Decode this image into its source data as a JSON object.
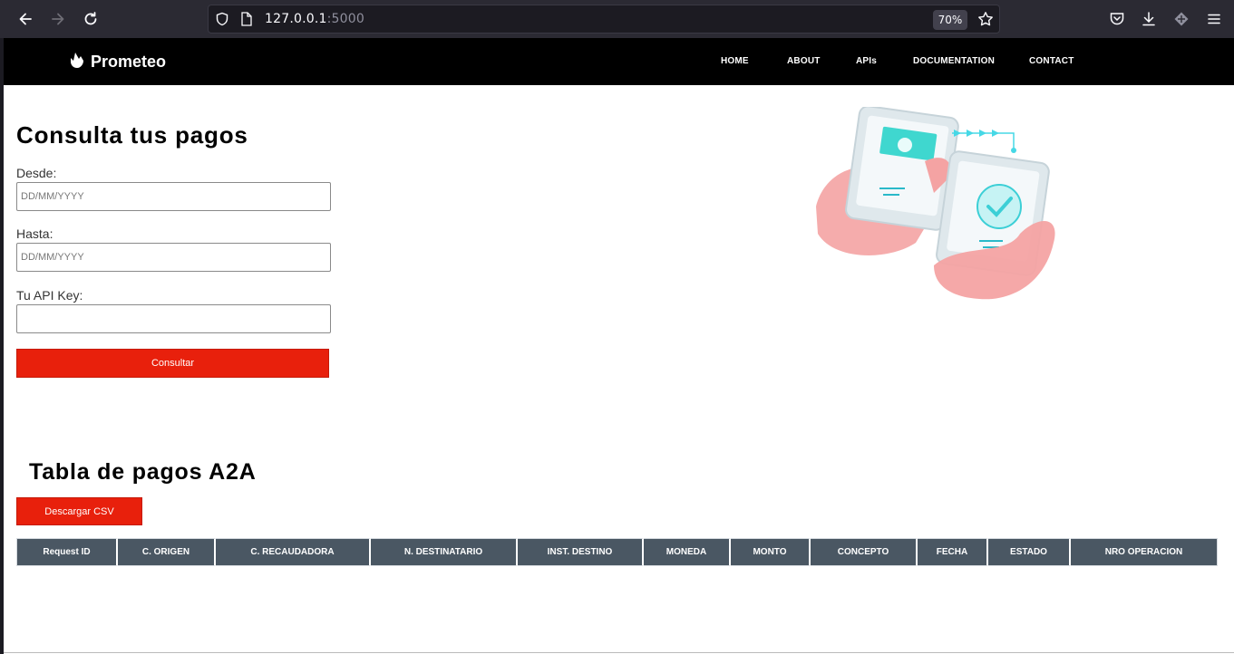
{
  "browser": {
    "url_host": "127.0.0.1",
    "url_port": ":5000",
    "zoom": "70%"
  },
  "nav": {
    "brand": "Prometeo",
    "links": [
      "HOME",
      "ABOUT",
      "APIs",
      "DOCUMENTATION",
      "CONTACT"
    ]
  },
  "form": {
    "title": "Consulta tus pagos",
    "desde_label": "Desde:",
    "desde_placeholder": "DD/MM/YYYY",
    "hasta_label": "Hasta:",
    "hasta_placeholder": "DD/MM/YYYY",
    "apikey_label": "Tu API Key:",
    "apikey_value": "",
    "submit_label": "Consultar"
  },
  "table": {
    "title": "Tabla de pagos A2A",
    "download_label": "Descargar CSV",
    "headers": [
      "Request ID",
      "C. ORIGEN",
      "C. RECAUDADORA",
      "N. DESTINATARIO",
      "INST. DESTINO",
      "MONEDA",
      "MONTO",
      "CONCEPTO",
      "FECHA",
      "ESTADO",
      "NRO OPERACION"
    ]
  },
  "colors": {
    "accent": "#e8200c",
    "table_header": "#4a5763",
    "navbar": "#000000"
  }
}
